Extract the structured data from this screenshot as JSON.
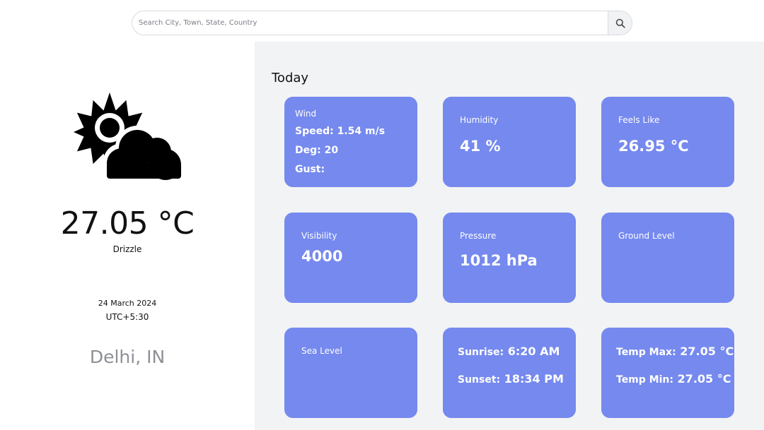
{
  "search": {
    "placeholder": "Search City, Town, State, Country",
    "value": "",
    "button_icon": "search-icon"
  },
  "current": {
    "icon": "sun-behind-cloud-icon",
    "temperature": "27.05 °C",
    "condition": "Drizzle",
    "date": "24 March 2024",
    "timezone": "UTC+5:30",
    "location": "Delhi, IN"
  },
  "today": {
    "title": "Today",
    "wind": {
      "label": "Wind",
      "speed": "Speed: 1.54 m/s",
      "deg": "Deg: 20",
      "gust": "Gust:"
    },
    "humidity": {
      "label": "Humidity",
      "value": "41 %"
    },
    "feels_like": {
      "label": "Feels Like",
      "value": "26.95 °C"
    },
    "visibility": {
      "label": "Visibility",
      "value": "4000"
    },
    "pressure": {
      "label": "Pressure",
      "value": "1012 hPa"
    },
    "ground_level": {
      "label": "Ground Level",
      "value": ""
    },
    "sea_level": {
      "label": "Sea Level",
      "value": ""
    },
    "sun": {
      "sunrise_label": "Sunrise:",
      "sunrise_value": "6:20 AM",
      "sunset_label": "Sunset:",
      "sunset_value": "18:34 PM"
    },
    "temp_range": {
      "max_label": "Temp Max:",
      "max_value": "27.05 °C",
      "min_label": "Temp Min:",
      "min_value": "27.05 °C"
    }
  },
  "colors": {
    "card_bg": "#7589ee",
    "panel_bg": "#f2f3f5",
    "location_text": "#8e9096"
  }
}
